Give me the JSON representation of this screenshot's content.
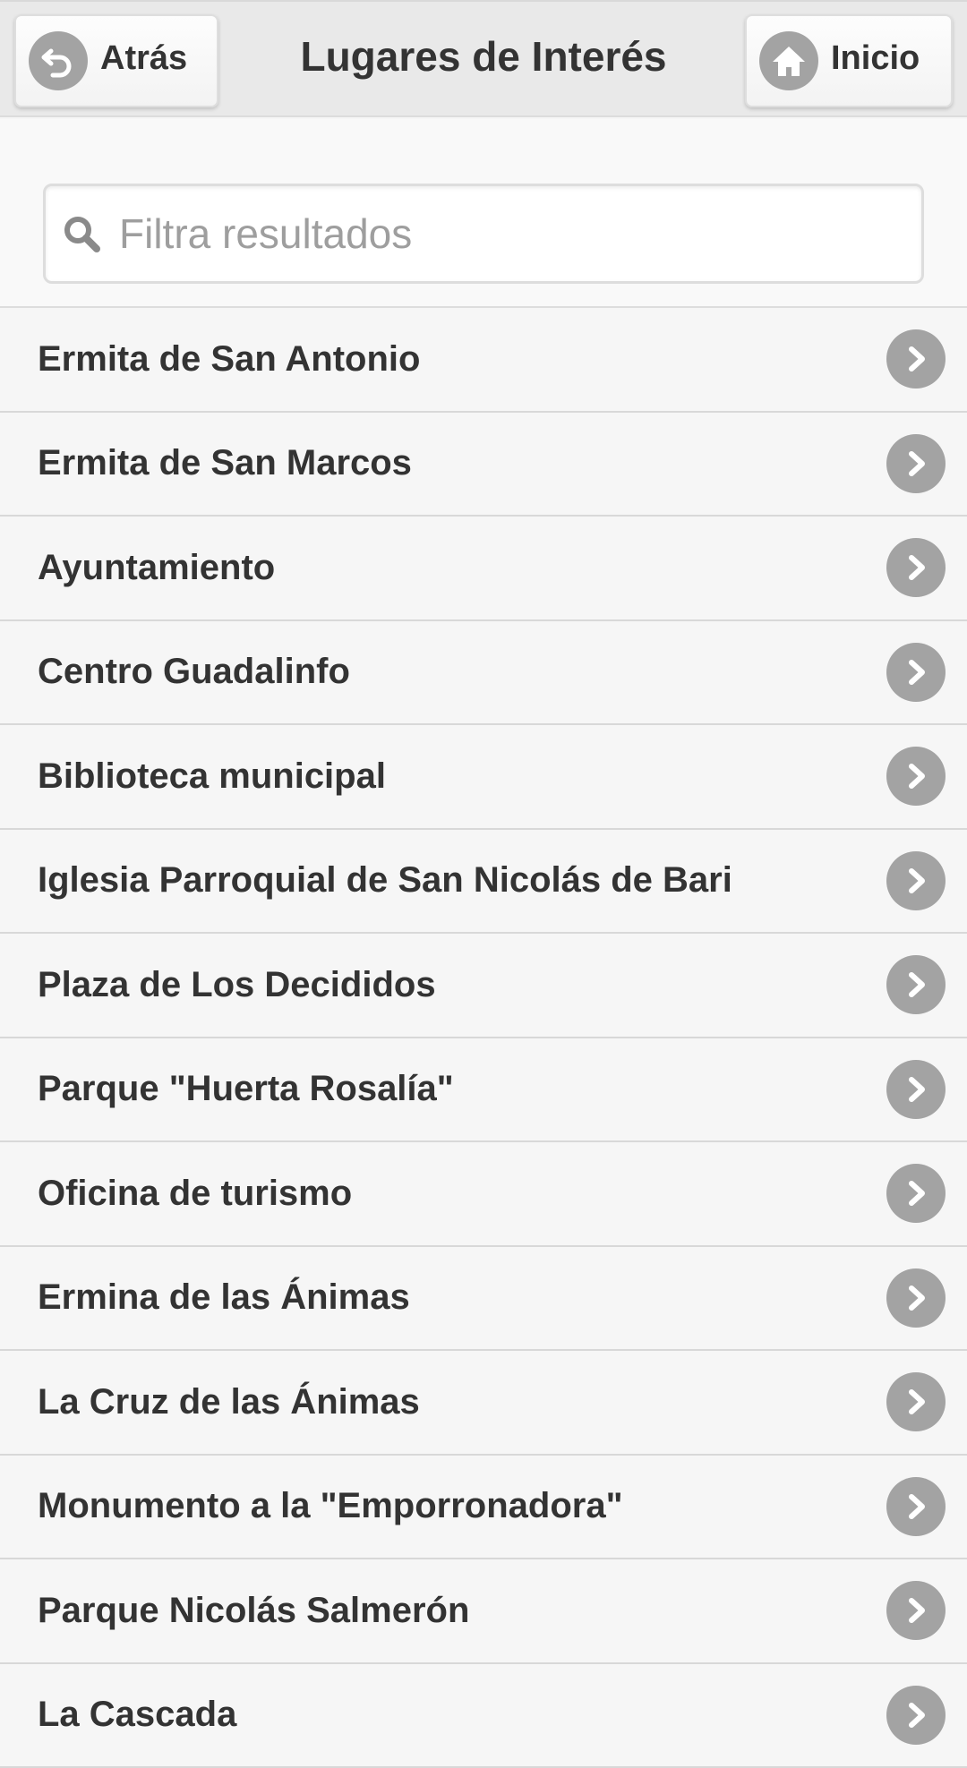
{
  "header": {
    "title": "Lugares de Interés",
    "back_label": "Atrás",
    "home_label": "Inicio",
    "back_icon": "back-arrow-icon",
    "home_icon": "home-icon"
  },
  "search": {
    "placeholder": "Filtra resultados",
    "value": "",
    "icon": "search-icon"
  },
  "list": {
    "items": [
      {
        "label": "Ermita de San Antonio"
      },
      {
        "label": "Ermita de San Marcos"
      },
      {
        "label": "Ayuntamiento"
      },
      {
        "label": "Centro Guadalinfo"
      },
      {
        "label": "Biblioteca municipal"
      },
      {
        "label": "Iglesia Parroquial de San Nicolás de Bari"
      },
      {
        "label": "Plaza de Los Decididos"
      },
      {
        "label": "Parque \"Huerta Rosalía\""
      },
      {
        "label": "Oficina de turismo"
      },
      {
        "label": "Ermina de las Ánimas"
      },
      {
        "label": "La Cruz de las Ánimas"
      },
      {
        "label": "Monumento a la \"Emporronadora\""
      },
      {
        "label": "Parque Nicolás Salmerón"
      },
      {
        "label": "La Cascada"
      }
    ],
    "item_icon": "chevron-right-icon"
  },
  "colors": {
    "header_bg": "#e9e9e9",
    "icon_circle": "#a3a3a3",
    "text": "#333333"
  }
}
